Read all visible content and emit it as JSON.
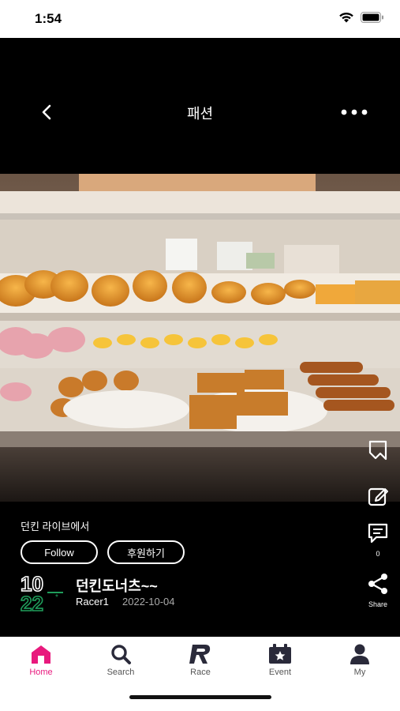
{
  "status_bar": {
    "time": "1:54"
  },
  "header": {
    "title": "패션"
  },
  "post": {
    "caption": "던킨 라이브에서",
    "follow_label": "Follow",
    "support_label": "후원하기",
    "title": "던킨도너츠~~",
    "username": "Racer1",
    "date": "2022-10-04",
    "avatar_text_top": "10",
    "avatar_text_bottom": "22"
  },
  "side_actions": {
    "comment_count": "0",
    "share_label": "Share"
  },
  "tabbar": {
    "tabs": [
      {
        "label": "Home",
        "icon": "home-icon",
        "active": true
      },
      {
        "label": "Search",
        "icon": "search-icon"
      },
      {
        "label": "Race",
        "icon": "race-icon"
      },
      {
        "label": "Event",
        "icon": "event-icon"
      },
      {
        "label": "My",
        "icon": "person-icon"
      }
    ]
  },
  "colors": {
    "accent": "#e8197d",
    "avatar_green": "#1f9d5b"
  }
}
